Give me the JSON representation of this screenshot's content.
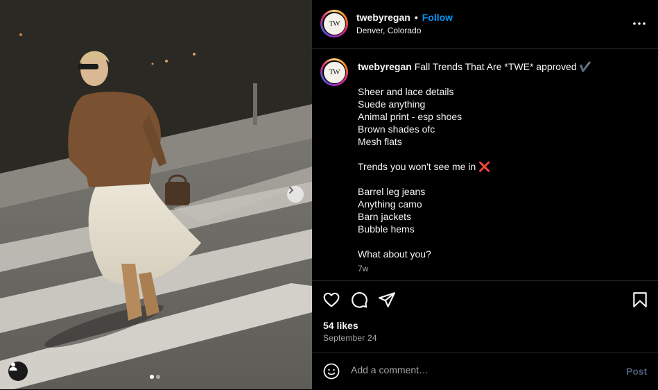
{
  "post": {
    "username": "twebyregan",
    "follow_label": "Follow",
    "separator": "•",
    "location": "Denver, Colorado",
    "avatar_monogram": "TW",
    "caption_title": "Fall Trends That Are *TWE* approved ✔️",
    "caption_body": "Sheer and lace details\nSuede anything\nAnimal print - esp shoes\nBrown shades ofc\nMesh flats\n\nTrends you won't see me in ❌\n\nBarrel leg jeans\nAnything camo\nBarn jackets\nBubble hems\n\nWhat about you?",
    "age": "7w",
    "likes": "54 likes",
    "date": "September 24"
  },
  "comment": {
    "placeholder": "Add a comment…",
    "post_label": "Post"
  },
  "carousel": {
    "slide_count": 2,
    "active_slide": 1
  },
  "colors": {
    "accent": "#0095f6",
    "background": "#000000",
    "muted": "#a8a8a8"
  },
  "icons": [
    "more-options-icon",
    "heart-icon",
    "comment-icon",
    "share-icon",
    "bookmark-icon",
    "emoji-icon",
    "chevron-right-icon",
    "user-tag-icon"
  ]
}
